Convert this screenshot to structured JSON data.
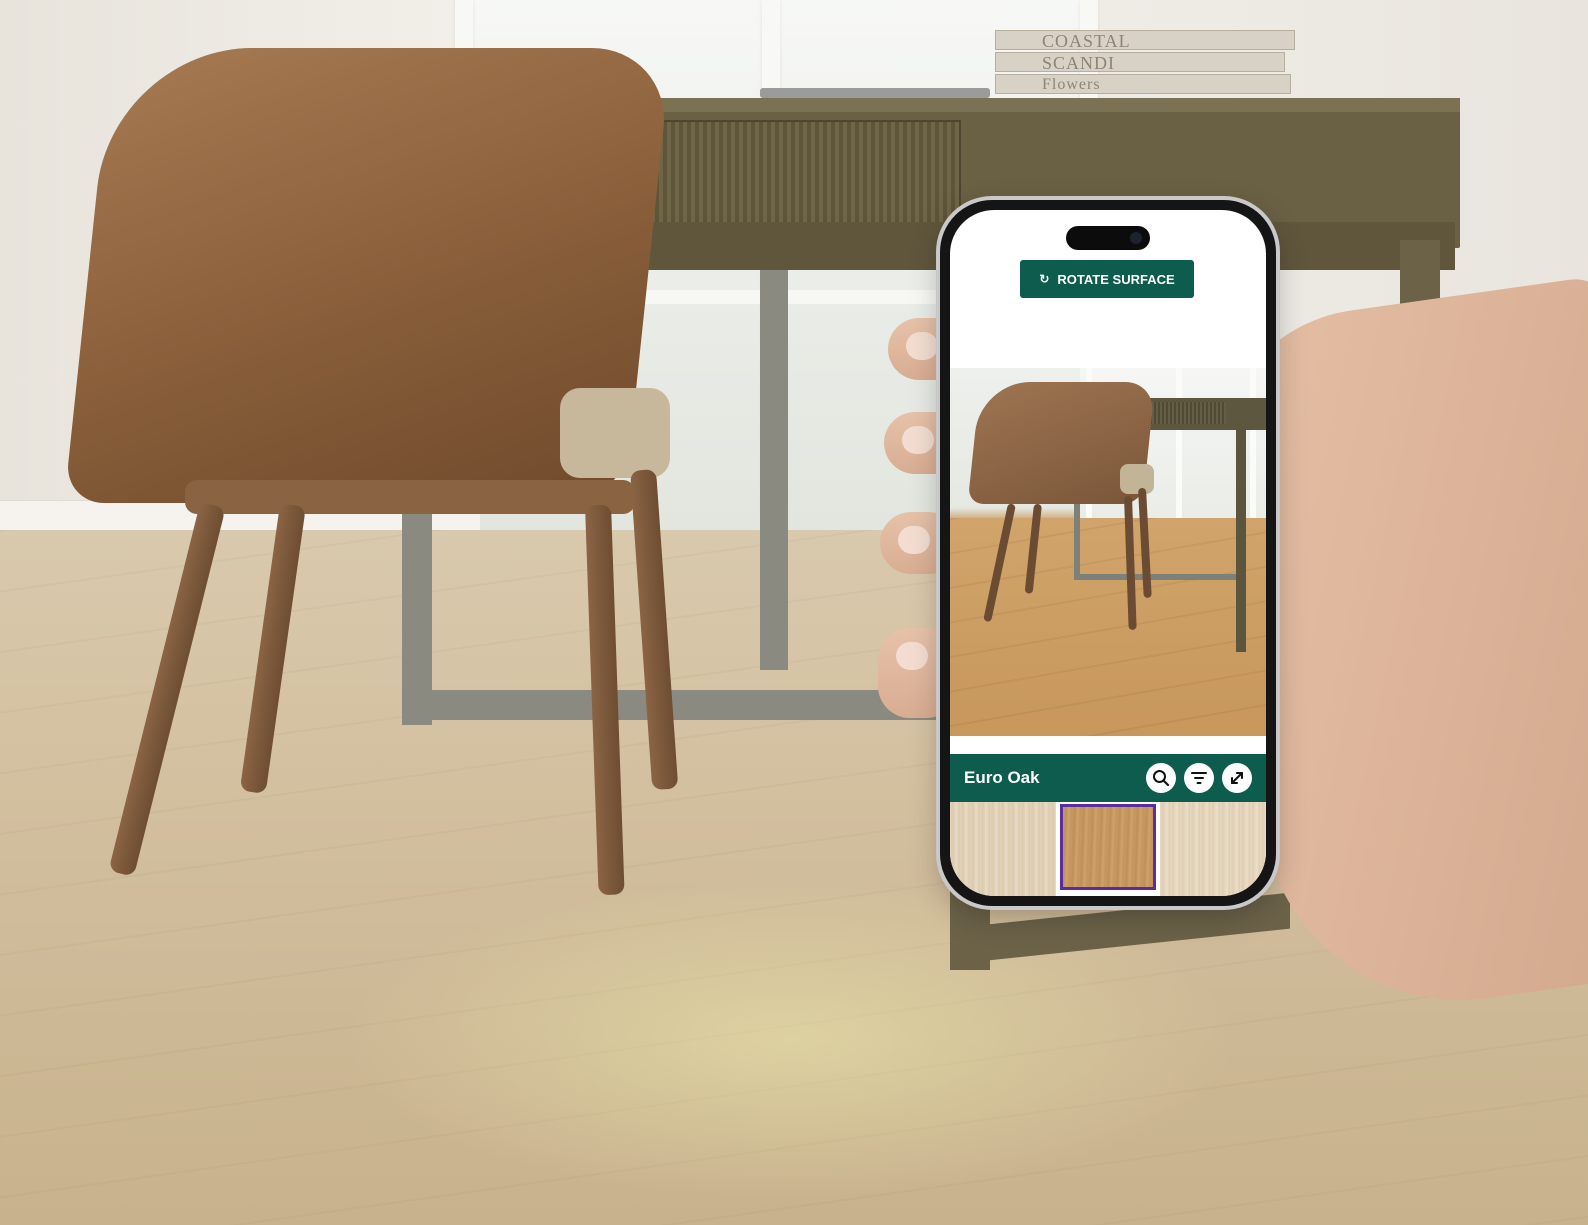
{
  "background": {
    "book_spines": [
      "COASTAL",
      "SCANDI",
      "Flowers"
    ]
  },
  "app": {
    "rotate_surface_label": "ROTATE SURFACE",
    "product_name": "Euro Oak",
    "icons": {
      "rotate": "rotate-icon",
      "search": "search-icon",
      "filter": "filter-icon",
      "expand": "expand-icon"
    },
    "selected_swatch_index": 1,
    "colors": {
      "brand_green": "#0d5c4e",
      "selection_purple": "#5a2da0"
    }
  }
}
